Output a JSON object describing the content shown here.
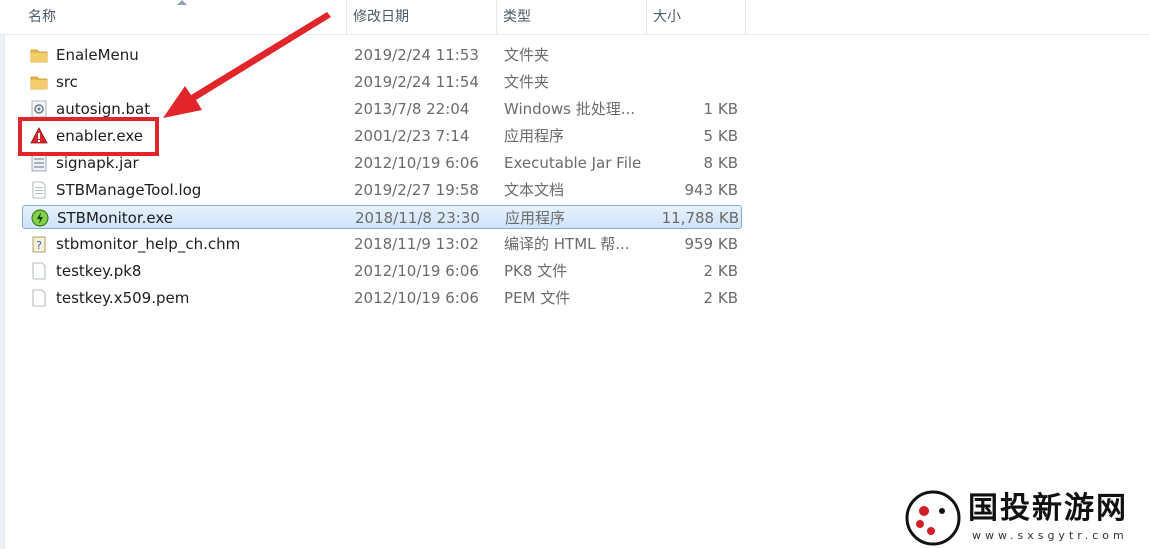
{
  "columns": {
    "name": "名称",
    "date": "修改日期",
    "type": "类型",
    "size": "大小"
  },
  "files": [
    {
      "name": "EnaleMenu",
      "date": "2019/2/24 11:53",
      "type": "文件夹",
      "size": "",
      "icon": "folder-icon"
    },
    {
      "name": "src",
      "date": "2019/2/24 11:54",
      "type": "文件夹",
      "size": "",
      "icon": "folder-icon"
    },
    {
      "name": "autosign.bat",
      "date": "2013/7/8 22:04",
      "type": "Windows 批处理...",
      "size": "1 KB",
      "icon": "batch-file-icon"
    },
    {
      "name": "enabler.exe",
      "date": "2001/2/23 7:14",
      "type": "应用程序",
      "size": "5 KB",
      "icon": "warning-app-icon"
    },
    {
      "name": "signapk.jar",
      "date": "2012/10/19 6:06",
      "type": "Executable Jar File",
      "size": "8 KB",
      "icon": "jar-file-icon"
    },
    {
      "name": "STBManageTool.log",
      "date": "2019/2/27 19:58",
      "type": "文本文档",
      "size": "943 KB",
      "icon": "text-file-icon"
    },
    {
      "name": "STBMonitor.exe",
      "date": "2018/11/8 23:30",
      "type": "应用程序",
      "size": "11,788 KB",
      "icon": "monitor-app-icon"
    },
    {
      "name": "stbmonitor_help_ch.chm",
      "date": "2018/11/9 13:02",
      "type": "编译的 HTML 帮...",
      "size": "959 KB",
      "icon": "help-file-icon"
    },
    {
      "name": "testkey.pk8",
      "date": "2012/10/19 6:06",
      "type": "PK8 文件",
      "size": "2 KB",
      "icon": "blank-file-icon"
    },
    {
      "name": "testkey.x509.pem",
      "date": "2012/10/19 6:06",
      "type": "PEM 文件",
      "size": "2 KB",
      "icon": "blank-file-icon"
    }
  ],
  "watermark": {
    "title": "国投新游网",
    "url": "www.sxsgytr.com"
  },
  "colors": {
    "annotation": "#e0262a",
    "selection": "#cfe3f9",
    "folder": "#e8b84a"
  }
}
